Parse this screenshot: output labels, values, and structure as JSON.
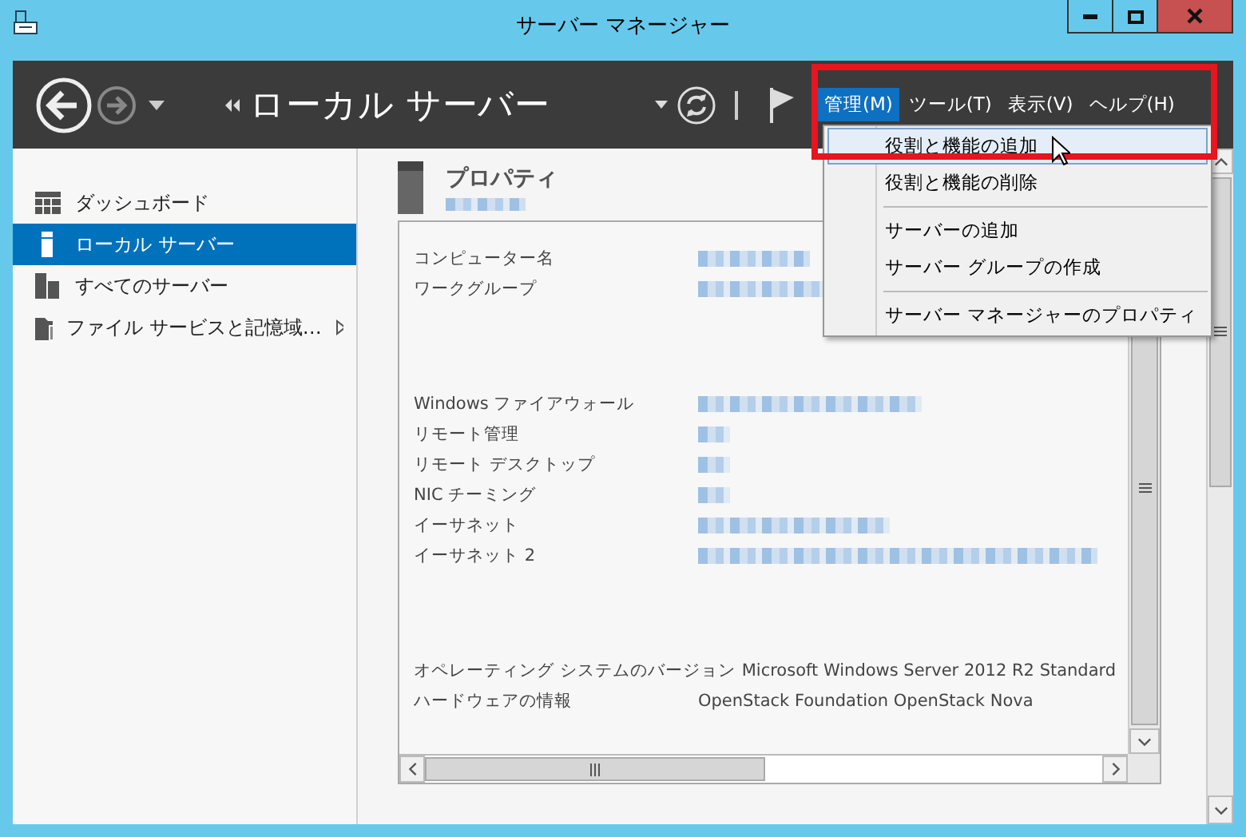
{
  "window": {
    "title": "サーバー マネージャー"
  },
  "toolbar": {
    "page_title": "ローカル サーバー",
    "menus": [
      {
        "label": "管理(M)",
        "selected": true
      },
      {
        "label": "ツール(T)",
        "selected": false
      },
      {
        "label": "表示(V)",
        "selected": false
      },
      {
        "label": "ヘルプ(H)",
        "selected": false
      }
    ]
  },
  "menu_dropdown": {
    "groups": [
      {
        "items": [
          {
            "label": "役割と機能の追加",
            "selected": true
          },
          {
            "label": "役割と機能の削除",
            "selected": false
          }
        ]
      },
      {
        "items": [
          {
            "label": "サーバーの追加",
            "selected": false
          },
          {
            "label": "サーバー グループの作成",
            "selected": false
          }
        ]
      },
      {
        "items": [
          {
            "label": "サーバー マネージャーのプロパティ",
            "selected": false
          }
        ]
      }
    ]
  },
  "nav": {
    "items": [
      {
        "kind": "dashboard",
        "label": "ダッシュボード",
        "selected": false,
        "has_submenu": false
      },
      {
        "kind": "local",
        "label": "ローカル サーバー",
        "selected": true,
        "has_submenu": false
      },
      {
        "kind": "all",
        "label": "すべてのサーバー",
        "selected": false,
        "has_submenu": false
      },
      {
        "kind": "storage",
        "label": "ファイル サービスと記憶域…",
        "selected": false,
        "has_submenu": true
      }
    ]
  },
  "properties": {
    "title": "プロパティ",
    "subtitle_redacted": true,
    "groups": [
      {
        "rows": [
          {
            "label": "コンピューター名",
            "redacted": true
          },
          {
            "label": "ワークグループ",
            "redacted": true
          }
        ]
      },
      {
        "rows": [
          {
            "label": "Windows ファイアウォール",
            "redacted": true
          },
          {
            "label": "リモート管理",
            "redacted": true
          },
          {
            "label": "リモート デスクトップ",
            "redacted": true
          },
          {
            "label": "NIC チーミング",
            "redacted": true
          },
          {
            "label": "イーサネット",
            "redacted": true
          },
          {
            "label": "イーサネット 2",
            "redacted": true
          }
        ]
      },
      {
        "rows": [
          {
            "label": "オペレーティング システムのバージョン",
            "value": "Microsoft Windows Server 2012 R2 Standard",
            "redacted": false
          },
          {
            "label": "ハードウェアの情報",
            "value": "OpenStack Foundation OpenStack Nova",
            "redacted": false
          }
        ]
      }
    ]
  },
  "annotation": {
    "kind": "highlight-frame"
  }
}
